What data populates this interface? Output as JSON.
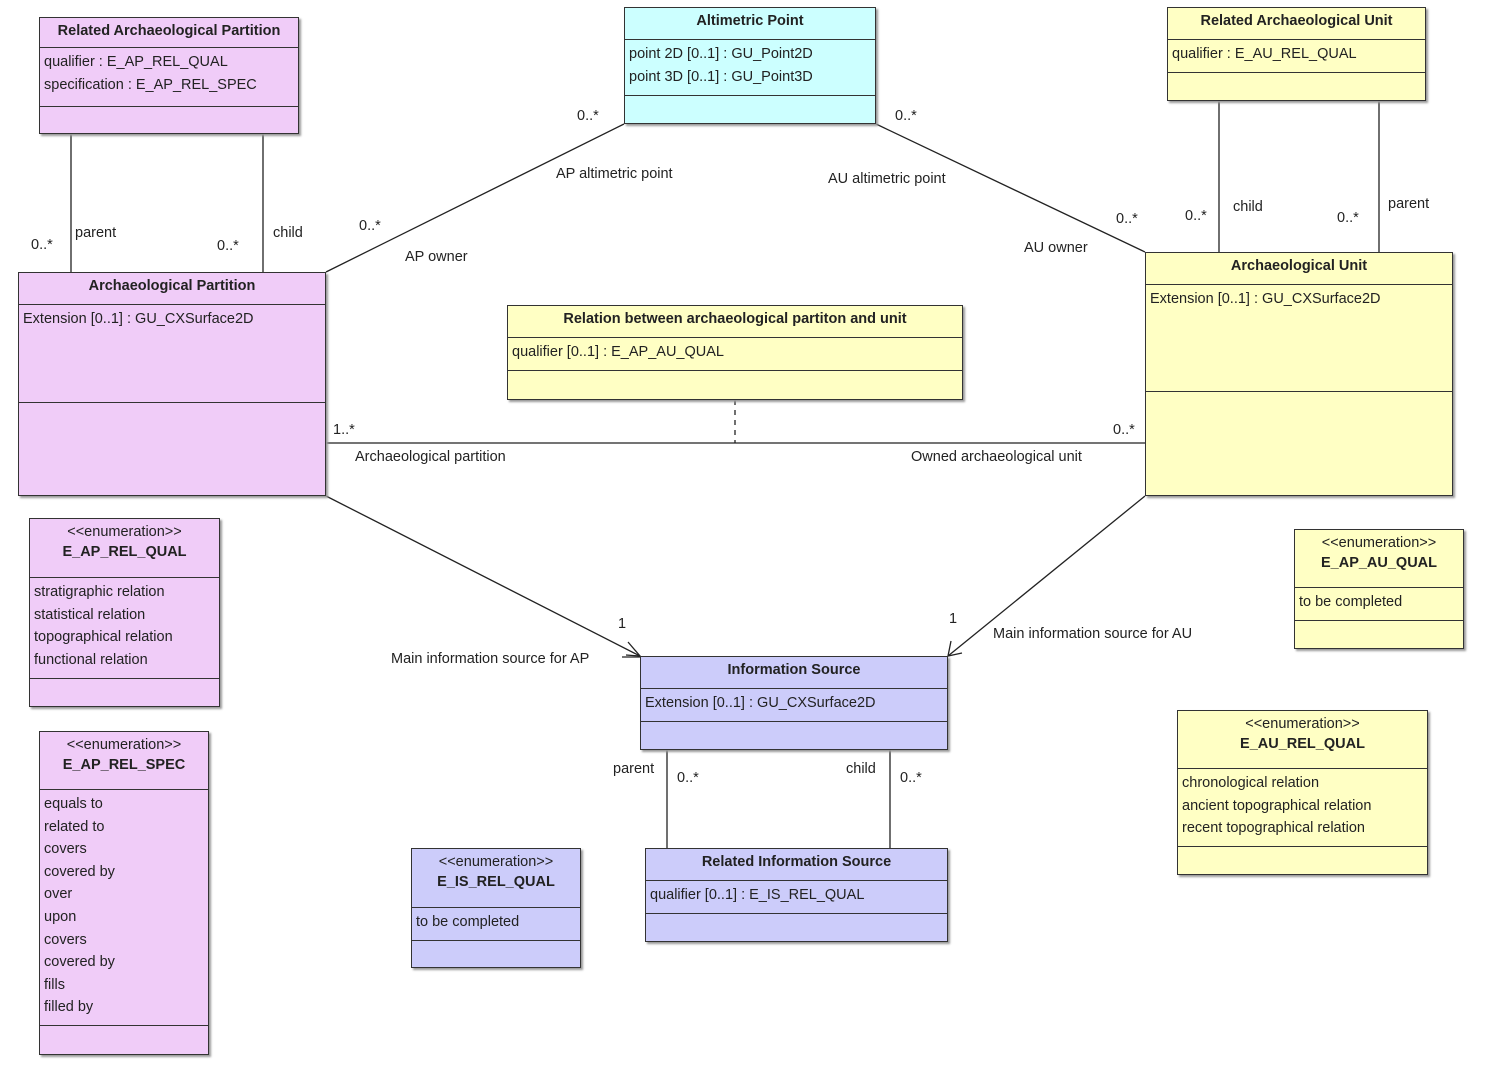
{
  "colors": {
    "partition": "#f0ccf8",
    "unit": "#ffffc4",
    "altimetric": "#ccffff",
    "source": "#ccccfa"
  },
  "classes": [
    {
      "id": "rap",
      "name": "Related Archaeological Partition",
      "color": "partition",
      "attributes": [
        "qualifier : E_AP_REL_QUAL",
        "specification : E_AP_REL_SPEC"
      ]
    },
    {
      "id": "alt",
      "name": "Altimetric Point",
      "color": "altimetric",
      "attributes": [
        "point 2D [0..1] : GU_Point2D",
        "point 3D [0..1] : GU_Point3D"
      ]
    },
    {
      "id": "rau",
      "name": "Related Archaeological Unit",
      "color": "unit",
      "attributes": [
        "qualifier : E_AU_REL_QUAL"
      ]
    },
    {
      "id": "ap",
      "name": "Archaeological Partition",
      "color": "partition",
      "attributes": [
        "Extension [0..1] : GU_CXSurface2D"
      ]
    },
    {
      "id": "au",
      "name": "Archaeological Unit",
      "color": "unit",
      "attributes": [
        "Extension [0..1] : GU_CXSurface2D"
      ]
    },
    {
      "id": "rel",
      "name": "Relation between archaeological partiton and unit",
      "color": "unit",
      "attributes": [
        "qualifier [0..1] : E_AP_AU_QUAL"
      ]
    },
    {
      "id": "eaprq",
      "name": "E_AP_REL_QUAL",
      "stereotype": "<<enumeration>>",
      "color": "partition",
      "attributes": [
        "stratigraphic relation",
        "statistical relation",
        "topographical relation",
        "functional relation"
      ]
    },
    {
      "id": "eaprs",
      "name": "E_AP_REL_SPEC",
      "stereotype": "<<enumeration>>",
      "color": "partition",
      "attributes": [
        "equals to",
        "related to",
        "covers",
        "covered by",
        "over",
        "upon",
        "covers",
        "covered by",
        "fills",
        "filled by"
      ]
    },
    {
      "id": "is",
      "name": "Information Source",
      "color": "source",
      "attributes": [
        "Extension [0..1] : GU_CXSurface2D"
      ]
    },
    {
      "id": "ris",
      "name": "Related Information Source",
      "color": "source",
      "attributes": [
        "qualifier [0..1] : E_IS_REL_QUAL"
      ]
    },
    {
      "id": "eis",
      "name": "E_IS_REL_QUAL",
      "stereotype": "<<enumeration>>",
      "color": "source",
      "attributes": [
        "to be completed"
      ]
    },
    {
      "id": "eapau",
      "name": "E_AP_AU_QUAL",
      "stereotype": "<<enumeration>>",
      "color": "unit",
      "attributes": [
        "to be completed"
      ]
    },
    {
      "id": "eaurq",
      "name": "E_AU_REL_QUAL",
      "stereotype": "<<enumeration>>",
      "color": "unit",
      "attributes": [
        "chronological relation",
        "ancient topographical relation",
        "recent topographical relation"
      ]
    }
  ],
  "labels": [
    "0..*",
    "AP altimetric point",
    "0..*",
    "AU altimetric point",
    "0..*",
    "AP owner",
    "0..*",
    "AU owner",
    "0..*",
    "parent",
    "0..*",
    "child",
    "0..*",
    "child",
    "0..*",
    "parent",
    "1..*",
    "Archaeological partition",
    "0..*",
    "Owned archaeological unit",
    "1",
    "Main information source for AP",
    "1",
    "Main information source for AU",
    "parent",
    "0..*",
    "child",
    "0..*"
  ]
}
